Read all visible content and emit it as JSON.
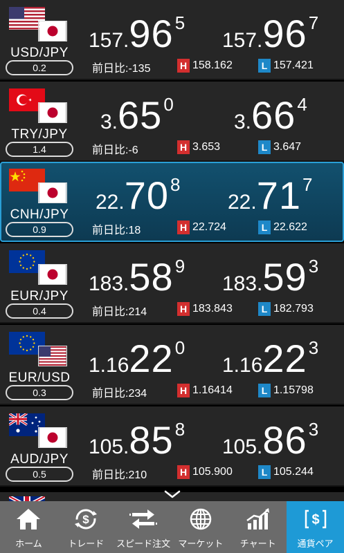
{
  "rows": [
    {
      "pair": "USD/JPY",
      "spread": "0.2",
      "base_flag": "us-flag",
      "quote_flag": "jp-flag",
      "bid": {
        "small": "157.",
        "big": "96",
        "sup": "5"
      },
      "ask": {
        "small": "157.",
        "big": "96",
        "sup": "7"
      },
      "change_label": "前日比:",
      "change": "-135",
      "high": "158.162",
      "low": "157.421"
    },
    {
      "pair": "TRY/JPY",
      "spread": "1.4",
      "base_flag": "tr-flag",
      "quote_flag": "jp-flag",
      "bid": {
        "small": "3.",
        "big": "65",
        "sup": "0"
      },
      "ask": {
        "small": "3.",
        "big": "66",
        "sup": "4"
      },
      "change_label": "前日比:",
      "change": "-6",
      "high": "3.653",
      "low": "3.647"
    },
    {
      "pair": "CNH/JPY",
      "spread": "0.9",
      "base_flag": "cn-flag",
      "quote_flag": "jp-flag",
      "bid": {
        "small": "22.",
        "big": "70",
        "sup": "8"
      },
      "ask": {
        "small": "22.",
        "big": "71",
        "sup": "7"
      },
      "change_label": "前日比:",
      "change": "18",
      "high": "22.724",
      "low": "22.622"
    },
    {
      "pair": "EUR/JPY",
      "spread": "0.4",
      "base_flag": "eu-flag",
      "quote_flag": "jp-flag",
      "bid": {
        "small": "183.",
        "big": "58",
        "sup": "9"
      },
      "ask": {
        "small": "183.",
        "big": "59",
        "sup": "3"
      },
      "change_label": "前日比:",
      "change": "214",
      "high": "183.843",
      "low": "182.793"
    },
    {
      "pair": "EUR/USD",
      "spread": "0.3",
      "base_flag": "eu-flag",
      "quote_flag": "us-flag",
      "bid": {
        "small": "1.16",
        "big": "22",
        "sup": "0"
      },
      "ask": {
        "small": "1.16",
        "big": "22",
        "sup": "3"
      },
      "change_label": "前日比:",
      "change": "234",
      "high": "1.16414",
      "low": "1.15798"
    },
    {
      "pair": "AUD/JPY",
      "spread": "0.5",
      "base_flag": "au-flag",
      "quote_flag": "jp-flag",
      "bid": {
        "small": "105.",
        "big": "85",
        "sup": "8"
      },
      "ask": {
        "small": "105.",
        "big": "86",
        "sup": "3"
      },
      "change_label": "前日比:",
      "change": "210",
      "high": "105.900",
      "low": "105.244"
    }
  ],
  "selected_row": 2,
  "high_tag": "H",
  "low_tag": "L",
  "colors": {
    "row_bg": "#262626",
    "selected_bg": "#0d3a52",
    "selected_border": "#2a9fd6",
    "high": "#d32f2f",
    "low": "#1e88c8",
    "tabbar": "#6b6b6b",
    "tab_active": "#1e9ad6"
  },
  "tabs": [
    {
      "label": "ホーム",
      "icon": "home-icon"
    },
    {
      "label": "トレード",
      "icon": "trade-icon"
    },
    {
      "label": "スピード注文",
      "icon": "speed-order-icon"
    },
    {
      "label": "マーケット",
      "icon": "globe-icon"
    },
    {
      "label": "チャート",
      "icon": "chart-icon"
    },
    {
      "label": "通貨ペア",
      "icon": "currency-pair-icon"
    }
  ],
  "active_tab": 5
}
